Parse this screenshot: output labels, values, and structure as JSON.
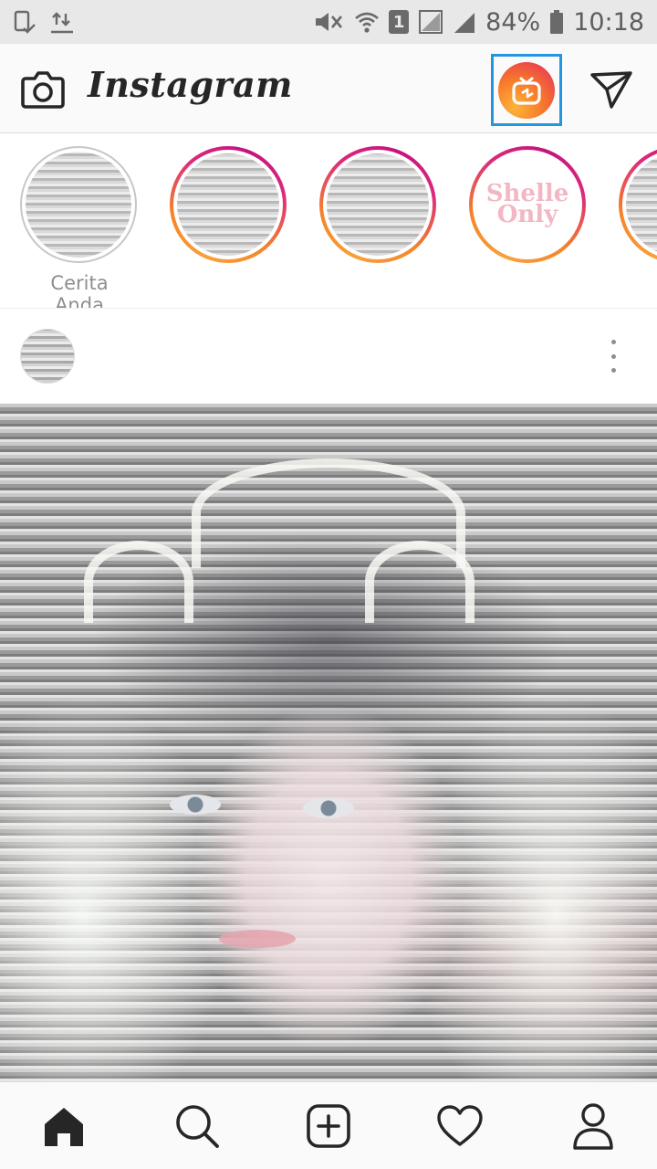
{
  "status_bar": {
    "battery": "84%",
    "time": "10:18",
    "sim_badge": "1",
    "icons": [
      "screenshot-icon",
      "data-transfer-icon",
      "mute-icon",
      "wifi-icon",
      "sim-icon",
      "signal-icon",
      "signal-icon-2",
      "battery-icon"
    ]
  },
  "app_bar": {
    "logo": "Instagram",
    "left_icon": "camera-icon",
    "igtv_icon": "igtv-icon",
    "right_icon": "direct-message-icon",
    "highlight_color": "#2496e0"
  },
  "stories": {
    "own_label": "Cerita Anda",
    "brand_story_text_1": "Shelle",
    "brand_story_text_2": "Only"
  },
  "post": {
    "menu_icon": "more-vertical-icon"
  },
  "bottom_nav": {
    "items": [
      "home-icon",
      "search-icon",
      "add-post-icon",
      "activity-heart-icon",
      "profile-icon"
    ]
  },
  "colors": {
    "story_ring_start": "#f58529",
    "story_ring_end": "#dd2a7b",
    "igtv_gradient_start": "#fdb43a",
    "igtv_gradient_end": "#e4295e"
  }
}
